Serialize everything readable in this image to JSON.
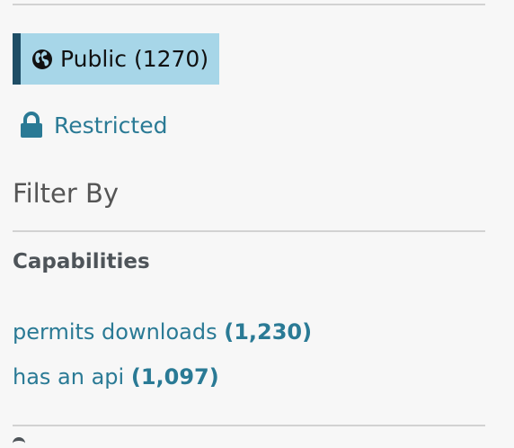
{
  "access": {
    "public": {
      "label": "Public",
      "count": "(1270)",
      "icon": "globe-icon"
    },
    "restricted": {
      "label": "Restricted",
      "icon": "lock-icon"
    }
  },
  "filter": {
    "heading": "Filter By",
    "sections": [
      {
        "title": "Capabilities",
        "facets": [
          {
            "label": "permits downloads",
            "count": "(1,230)"
          },
          {
            "label": "has an api",
            "count": "(1,097)"
          }
        ]
      }
    ]
  },
  "colors": {
    "link": "#2a7a95",
    "active_bg": "#a7d6e8",
    "active_border": "#1f4e66",
    "divider": "#d2d2d2",
    "heading": "#555555"
  }
}
